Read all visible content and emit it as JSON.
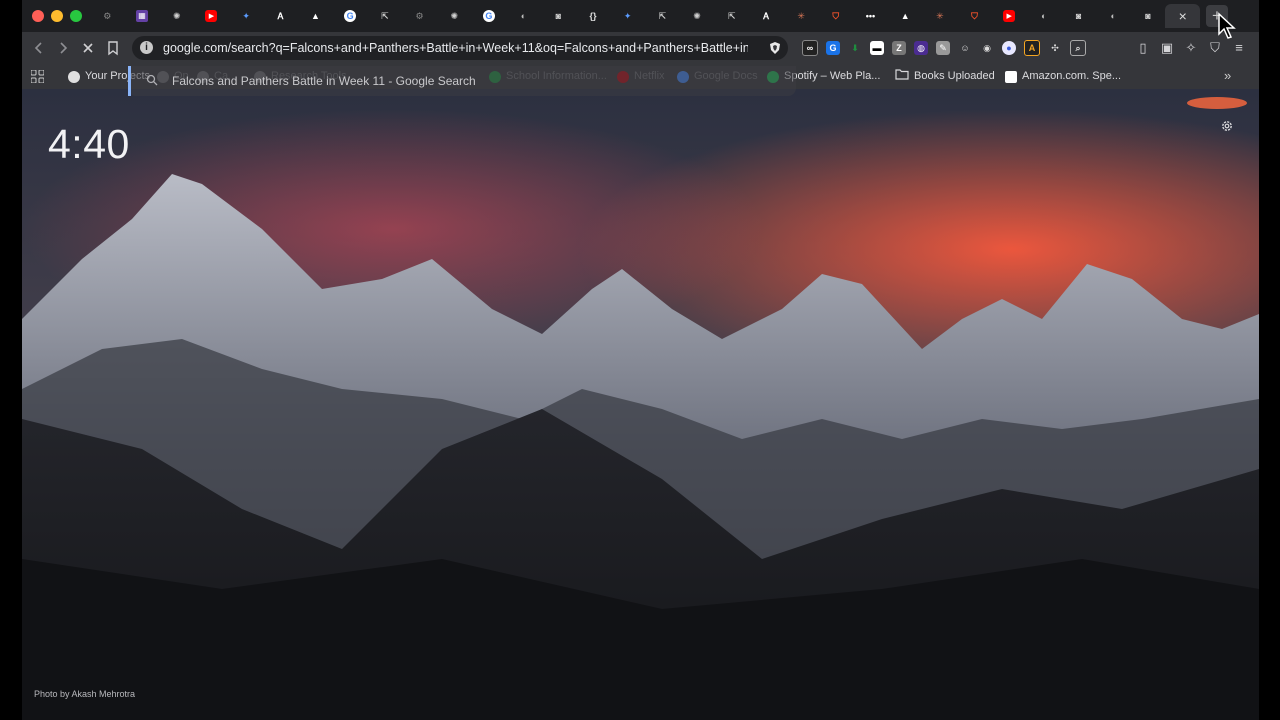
{
  "browser": {
    "url": "google.com/search?q=Falcons+and+Panthers+Battle+in+Week+11&oq=Falcons+and+Panthers+Battle+in+...",
    "tabs": [
      {
        "icon": "generic-icon",
        "color": "#8a8a8a"
      },
      {
        "icon": "twitch-icon",
        "color": "#6441a5"
      },
      {
        "icon": "openai-icon",
        "color": "#cfcfcf"
      },
      {
        "icon": "youtube-icon",
        "color": "#ff0000"
      },
      {
        "icon": "gemini-icon",
        "color": "#5b9cff"
      },
      {
        "icon": "ai-icon",
        "color": "#ffffff"
      },
      {
        "icon": "triangle-icon",
        "color": "#ffffff"
      },
      {
        "icon": "google-icon",
        "color": "#4285f4"
      },
      {
        "icon": "export-icon",
        "color": "#cfcfcf"
      },
      {
        "icon": "generic-icon",
        "color": "#8a8a8a"
      },
      {
        "icon": "openai-icon",
        "color": "#cfcfcf"
      },
      {
        "icon": "google-icon",
        "color": "#4285f4"
      },
      {
        "icon": "globe-icon",
        "color": "#bdbdbd"
      },
      {
        "icon": "camera-icon",
        "color": "#d0d0d0"
      },
      {
        "icon": "braces-icon",
        "color": "#e0e0e0"
      },
      {
        "icon": "gemini-icon",
        "color": "#5b9cff"
      },
      {
        "icon": "export-icon",
        "color": "#cfcfcf"
      },
      {
        "icon": "openai-icon",
        "color": "#cfcfcf"
      },
      {
        "icon": "export-icon",
        "color": "#cfcfcf"
      },
      {
        "icon": "ai-icon",
        "color": "#ffffff"
      },
      {
        "icon": "claude-icon",
        "color": "#d97757"
      },
      {
        "icon": "brave-icon",
        "color": "#fb542b"
      },
      {
        "icon": "dots-icon",
        "color": "#ffffff"
      },
      {
        "icon": "triangle-icon",
        "color": "#ffffff"
      },
      {
        "icon": "claude-icon",
        "color": "#d97757"
      },
      {
        "icon": "brave-icon",
        "color": "#fb542b"
      },
      {
        "icon": "youtube-icon",
        "color": "#ff0000"
      },
      {
        "icon": "globe-icon",
        "color": "#bdbdbd"
      },
      {
        "icon": "camera-icon",
        "color": "#d0d0d0"
      },
      {
        "icon": "globe-icon",
        "color": "#bdbdbd"
      },
      {
        "icon": "camera-icon",
        "color": "#d0d0d0"
      },
      {
        "icon": "close-icon",
        "color": "#dddddd",
        "active": true
      }
    ],
    "new_tab_label": "+",
    "close_label": "×"
  },
  "bookmarks": {
    "items": [
      {
        "label": "Your Projects",
        "dim": false,
        "color": "#e0e0e0"
      },
      {
        "label": "Op...",
        "dim": true,
        "color": "#6b6c70"
      },
      {
        "label": "Ca...",
        "dim": true,
        "color": "#6b6c70"
      },
      {
        "label": "Research Tools",
        "dim": true,
        "color": "#6b6c70"
      },
      {
        "label": "School Information...",
        "dim": true,
        "color": "#1e8e3e"
      },
      {
        "label": "Netflix",
        "dim": true,
        "color": "#b20710"
      },
      {
        "label": "Google Docs",
        "dim": true,
        "color": "#4285f4"
      },
      {
        "label": "Spotify – Web Pla...",
        "dim": false,
        "color": "#1db954"
      },
      {
        "label": "Books Uploaded",
        "dim": false,
        "color": "folder"
      },
      {
        "label": "Amazon.com. Spe...",
        "dim": false,
        "color": "#ffffff"
      }
    ],
    "more_label": "»"
  },
  "suggestion": {
    "text": "Falcons and Panthers Battle in Week 11 - Google Search"
  },
  "ntp": {
    "clock": "4:40",
    "photo_credit": "Photo by Akash Mehrotra"
  },
  "colors": {
    "accent": "#8ab4f8",
    "toolbar": "#35363a",
    "tabstrip": "#1e1f22"
  }
}
